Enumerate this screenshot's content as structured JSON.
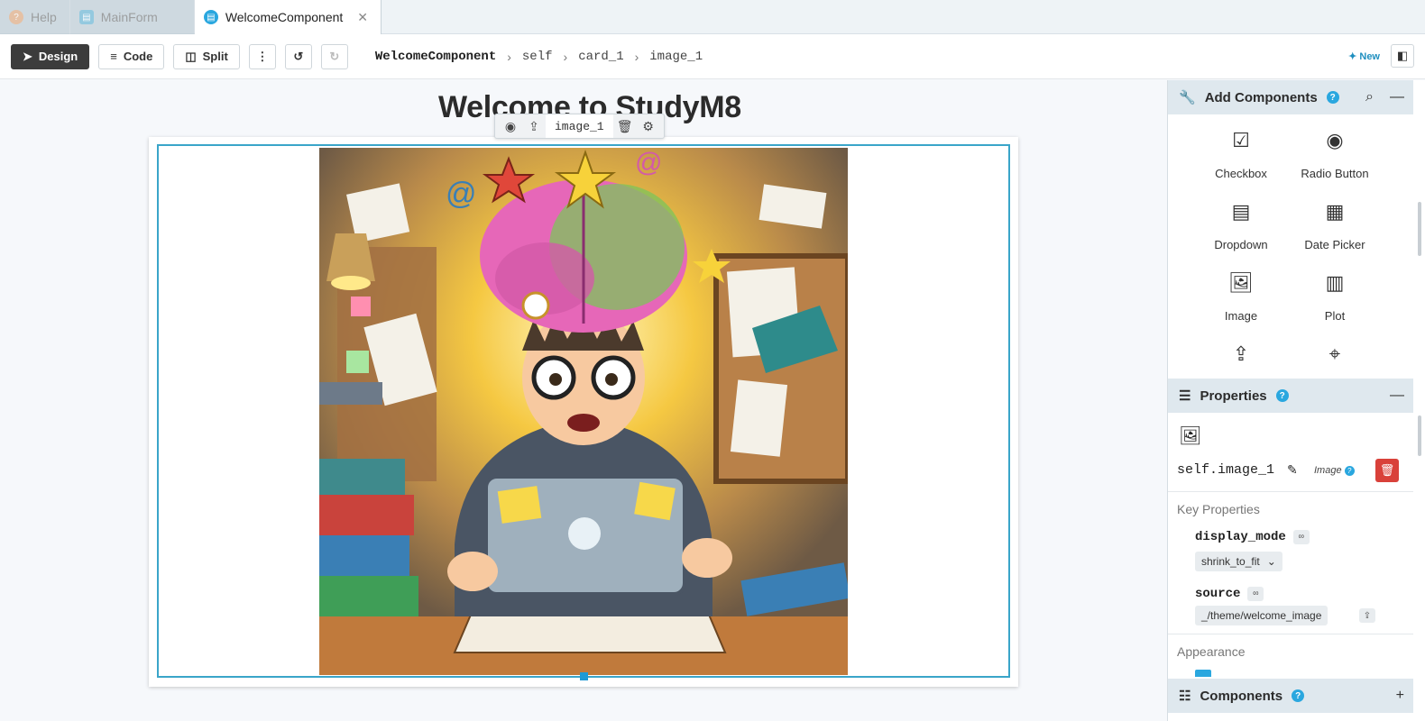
{
  "tabs": [
    {
      "label": "Help",
      "icon": "help-icon"
    },
    {
      "label": "MainForm",
      "icon": "form-icon"
    },
    {
      "label": "WelcomeComponent",
      "icon": "form-icon"
    }
  ],
  "toolbar": {
    "design_label": "Design",
    "code_label": "Code",
    "split_label": "Split",
    "new_label": "New",
    "breadcrumb": [
      "WelcomeComponent",
      "self",
      "card_1",
      "image_1"
    ]
  },
  "canvas": {
    "heading": "Welcome to StudyM8",
    "selected_label": "image_1"
  },
  "add_components": {
    "title": "Add Components",
    "items": [
      "Checkbox",
      "Radio Button",
      "Dropdown",
      "Date Picker",
      "Image",
      "Plot"
    ]
  },
  "properties": {
    "title": "Properties",
    "name": "self.image_1",
    "type": "Image",
    "key_properties_label": "Key Properties",
    "display_mode_label": "display_mode",
    "display_mode_value": "shrink_to_fit",
    "source_label": "source",
    "source_value": "_/theme/welcome_image",
    "appearance_label": "Appearance"
  },
  "components_panel": {
    "title": "Components"
  },
  "colors": {
    "accent": "#2aa7df",
    "selection": "#3aa5c9",
    "danger": "#d9413a"
  }
}
